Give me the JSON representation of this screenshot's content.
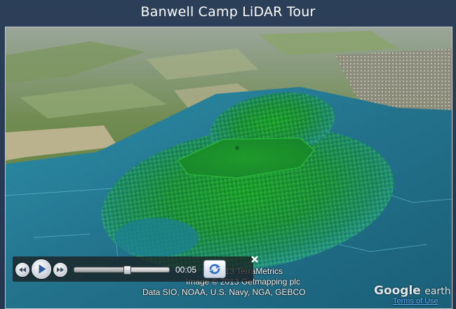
{
  "window": {
    "title": "Banwell Camp LiDAR Tour"
  },
  "tour_player": {
    "elapsed_time": "00:05",
    "progress": 0.55,
    "controls": [
      "rewind",
      "play",
      "fast-forward",
      "loop",
      "close"
    ]
  },
  "attribution": {
    "line1": "© 2013 TerraMetrics",
    "line2": "Image © 2013 Getmapping plc",
    "line3": "Data SIO, NOAA, U.S. Navy, NGA, GEBCO"
  },
  "logo": {
    "brand": "Google",
    "product": "earth"
  },
  "links": {
    "terms": "Terms of Use"
  },
  "icons": {
    "rewind": "rewind-icon",
    "play": "play-icon",
    "fast_forward": "fast-forward-icon",
    "loop": "loop-icon",
    "close": "close-icon"
  },
  "colors": {
    "title_bar": "#2c3f58",
    "lidar_low": "#1f7d9a",
    "lidar_high": "#1e9e2a",
    "link": "#5fb0ff"
  }
}
